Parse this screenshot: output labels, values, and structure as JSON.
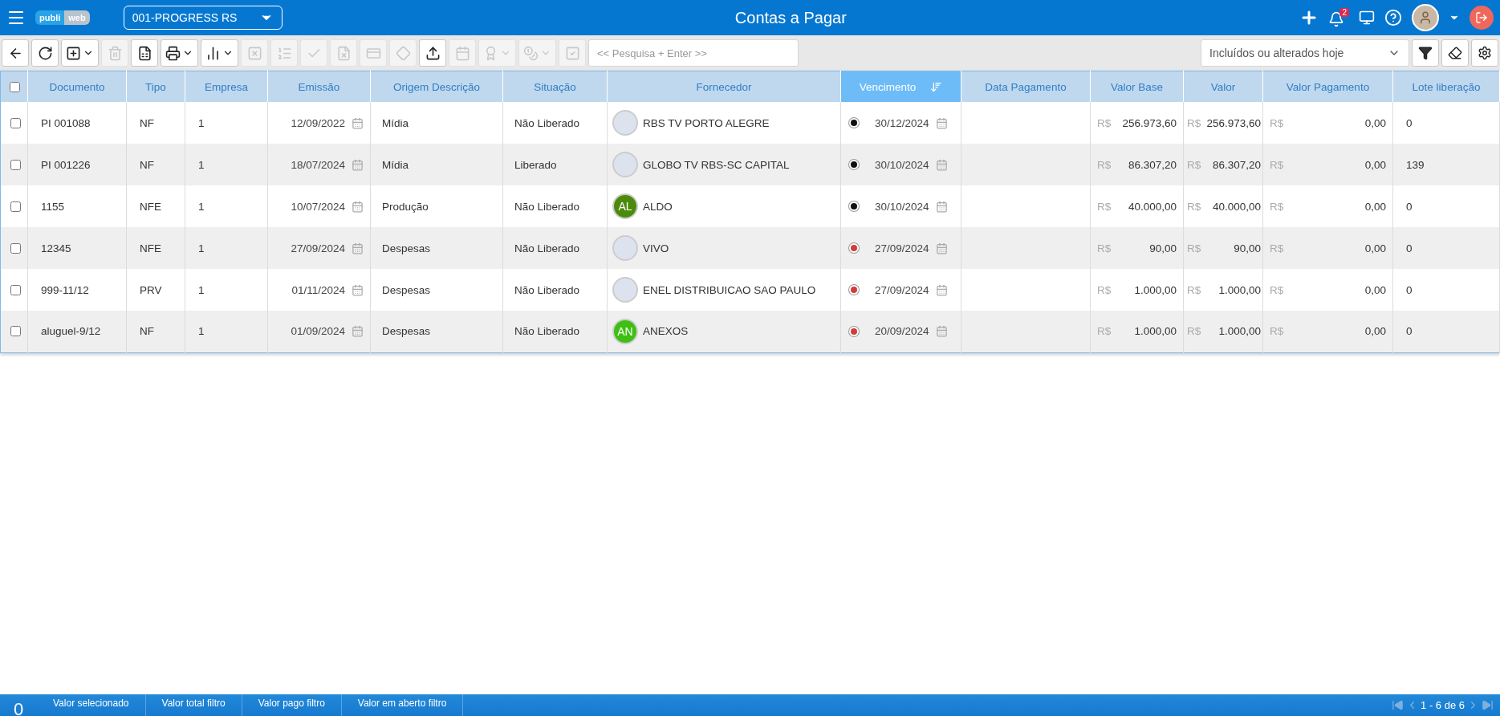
{
  "app": {
    "logo_left": "publi",
    "logo_right": "web",
    "company": "001-PROGRESS RS",
    "title": "Contas a Pagar",
    "notifications": "2"
  },
  "toolbar": [
    {
      "kind": "back",
      "disabled": false,
      "dropdown": false
    },
    {
      "kind": "refresh",
      "disabled": false,
      "dropdown": false
    },
    {
      "kind": "add",
      "disabled": false,
      "dropdown": true
    },
    {
      "kind": "trash",
      "disabled": true,
      "dropdown": false
    },
    {
      "kind": "excel",
      "disabled": false,
      "dropdown": false
    },
    {
      "kind": "print",
      "disabled": false,
      "dropdown": true
    },
    {
      "kind": "chart",
      "disabled": false,
      "dropdown": true
    },
    {
      "kind": "xbox",
      "disabled": true,
      "dropdown": false
    },
    {
      "kind": "numlist",
      "disabled": true,
      "dropdown": false
    },
    {
      "kind": "check",
      "disabled": true,
      "dropdown": false
    },
    {
      "kind": "filex",
      "disabled": true,
      "dropdown": false
    },
    {
      "kind": "card",
      "disabled": true,
      "dropdown": false
    },
    {
      "kind": "diamond",
      "disabled": true,
      "dropdown": false
    },
    {
      "kind": "upload",
      "disabled": false,
      "dropdown": false
    },
    {
      "kind": "calendar",
      "disabled": true,
      "dropdown": false
    },
    {
      "kind": "award",
      "disabled": true,
      "dropdown": true
    },
    {
      "kind": "coins",
      "disabled": true,
      "dropdown": true
    },
    {
      "kind": "checkbox",
      "disabled": true,
      "dropdown": false
    }
  ],
  "search": {
    "placeholder": "<< Pesquisa + Enter >>"
  },
  "filter": {
    "value": "Incluídos ou alterados hoje"
  },
  "table": {
    "select_all": {
      "checked": false
    },
    "columns": [
      {
        "label": "Documento",
        "sorted": false
      },
      {
        "label": "Tipo",
        "sorted": false
      },
      {
        "label": "Empresa",
        "sorted": false
      },
      {
        "label": "Emissão",
        "sorted": false
      },
      {
        "label": "Origem Descrição",
        "sorted": false
      },
      {
        "label": "Situação",
        "sorted": false
      },
      {
        "label": "Fornecedor",
        "sorted": false
      },
      {
        "label": "Vencimento",
        "sorted": true
      },
      {
        "label": "Data Pagamento",
        "sorted": false
      },
      {
        "label": "Valor Base",
        "sorted": false
      },
      {
        "label": "Valor",
        "sorted": false
      },
      {
        "label": "Valor Pagamento",
        "sorted": false
      },
      {
        "label": "Lote liberação",
        "sorted": false
      }
    ],
    "rows": [
      {
        "checked": false,
        "documento": "PI 001088",
        "tipo": "NF",
        "empresa": "1",
        "emissao": "12/09/2022",
        "origem": "Mídia",
        "situacao": "Não Liberado",
        "fornecedor": {
          "kind": "logo",
          "name": "RBS TV PORTO ALEGRE"
        },
        "color": "#111111",
        "vencimento": "30/12/2024",
        "currency": [
          "R$",
          "R$",
          "R$"
        ],
        "valor_base": "256.973,60",
        "valor": "256.973,60",
        "valor_pagamento": "0,00",
        "lote": "0"
      },
      {
        "checked": false,
        "documento": "PI 001226",
        "tipo": "NF",
        "empresa": "1",
        "emissao": "18/07/2024",
        "origem": "Mídia",
        "situacao": "Liberado",
        "fornecedor": {
          "kind": "logo",
          "name": "GLOBO TV RBS-SC CAPITAL"
        },
        "color": "#111111",
        "vencimento": "30/10/2024",
        "currency": [
          "R$",
          "R$",
          "R$"
        ],
        "valor_base": "86.307,20",
        "valor": "86.307,20",
        "valor_pagamento": "0,00",
        "lote": "139"
      },
      {
        "checked": false,
        "documento": "1155",
        "tipo": "NFE",
        "empresa": "1",
        "emissao": "10/07/2024",
        "origem": "Produção",
        "situacao": "Não Liberado",
        "fornecedor": {
          "kind": "initials",
          "initials": "AL",
          "color": "#4c8a0c",
          "name": "ALDO"
        },
        "color": "#111111",
        "vencimento": "30/10/2024",
        "currency": [
          "R$",
          "R$",
          "R$"
        ],
        "valor_base": "40.000,00",
        "valor": "40.000,00",
        "valor_pagamento": "0,00",
        "lote": "0"
      },
      {
        "checked": false,
        "documento": "12345",
        "tipo": "NFE",
        "empresa": "1",
        "emissao": "27/09/2024",
        "origem": "Despesas",
        "situacao": "Não Liberado",
        "fornecedor": {
          "kind": "logo",
          "name": "VIVO"
        },
        "color": "#d23c3c",
        "vencimento": "27/09/2024",
        "currency": [
          "R$",
          "R$",
          "R$"
        ],
        "valor_base": "90,00",
        "valor": "90,00",
        "valor_pagamento": "0,00",
        "lote": "0"
      },
      {
        "checked": false,
        "documento": "999-11/12",
        "tipo": "PRV",
        "empresa": "1",
        "emissao": "01/11/2024",
        "origem": "Despesas",
        "situacao": "Não Liberado",
        "fornecedor": {
          "kind": "logo",
          "name": "ENEL DISTRIBUICAO SAO PAULO"
        },
        "color": "#d23c3c",
        "vencimento": "27/09/2024",
        "currency": [
          "R$",
          "R$",
          "R$"
        ],
        "valor_base": "1.000,00",
        "valor": "1.000,00",
        "valor_pagamento": "0,00",
        "lote": "0"
      },
      {
        "checked": false,
        "documento": "aluguel-9/12",
        "tipo": "NF",
        "empresa": "1",
        "emissao": "01/09/2024",
        "origem": "Despesas",
        "situacao": "Não Liberado",
        "fornecedor": {
          "kind": "initials",
          "initials": "AN",
          "color": "#3fbf12",
          "name": "ANEXOS"
        },
        "color": "#d23c3c",
        "vencimento": "20/09/2024",
        "currency": [
          "R$",
          "R$",
          "R$"
        ],
        "valor_base": "1.000,00",
        "valor": "1.000,00",
        "valor_pagamento": "0,00",
        "lote": "0"
      }
    ]
  },
  "footer": {
    "count": "0",
    "labels": [
      "Valor selecionado",
      "Valor total filtro",
      "Valor pago filtro",
      "Valor em aberto filtro"
    ],
    "pager": "1 - 6 de 6"
  }
}
